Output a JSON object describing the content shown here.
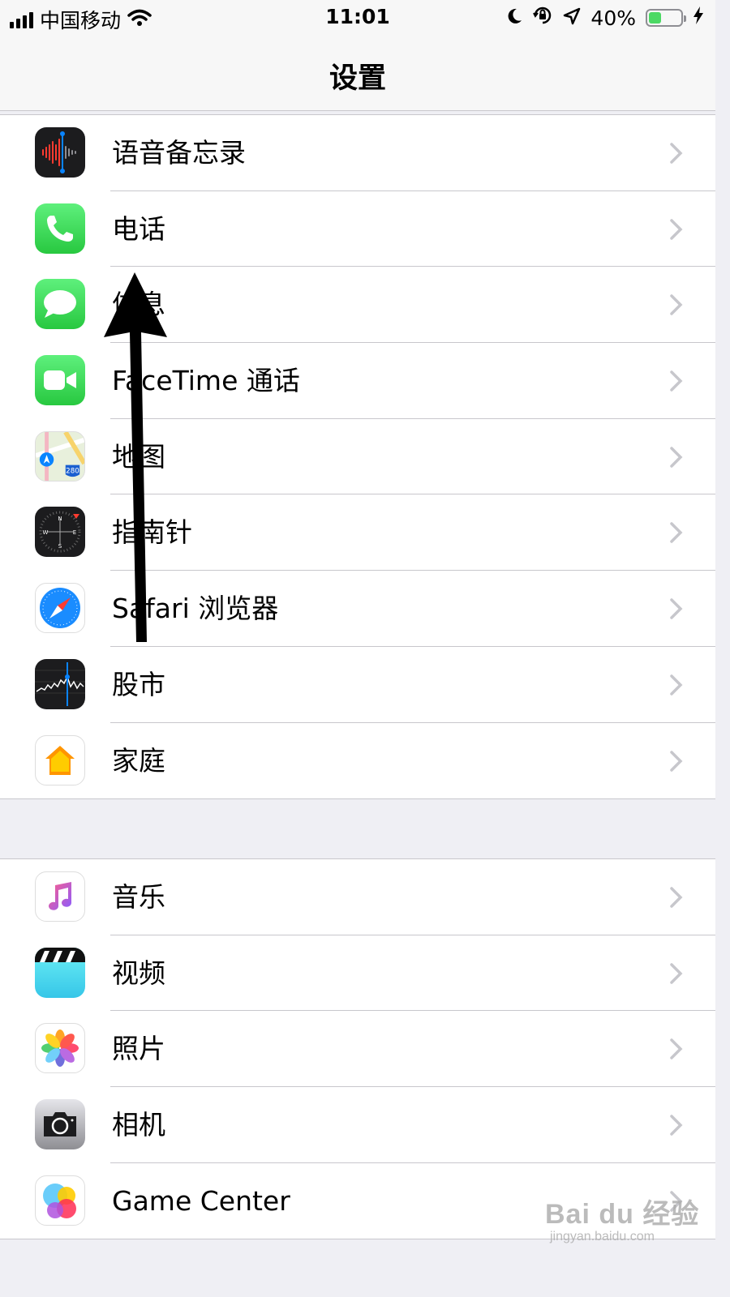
{
  "status_bar": {
    "carrier": "中国移动",
    "time": "11:01",
    "battery_percent": "40%",
    "battery_level": 0.4,
    "icons": [
      "signal-icon",
      "wifi-icon",
      "moon-icon",
      "orientation-lock-icon",
      "location-icon",
      "battery-icon",
      "charging-icon"
    ]
  },
  "header": {
    "title": "设置"
  },
  "groups": [
    {
      "items": [
        {
          "label": "语音备忘录",
          "icon": "voice-memos-icon"
        },
        {
          "label": "电话",
          "icon": "phone-icon"
        },
        {
          "label": "信息",
          "icon": "messages-icon"
        },
        {
          "label": "FaceTime 通话",
          "icon": "facetime-icon"
        },
        {
          "label": "地图",
          "icon": "maps-icon"
        },
        {
          "label": "指南针",
          "icon": "compass-icon"
        },
        {
          "label": "Safari 浏览器",
          "icon": "safari-icon"
        },
        {
          "label": "股市",
          "icon": "stocks-icon"
        },
        {
          "label": "家庭",
          "icon": "home-icon"
        }
      ]
    },
    {
      "items": [
        {
          "label": "音乐",
          "icon": "music-icon"
        },
        {
          "label": "视频",
          "icon": "videos-icon"
        },
        {
          "label": "照片",
          "icon": "photos-icon"
        },
        {
          "label": "相机",
          "icon": "camera-icon"
        },
        {
          "label": "Game Center",
          "icon": "game-center-icon"
        }
      ]
    }
  ],
  "watermark": {
    "brand": "Bai du 经验",
    "url": "jingyan.baidu.com"
  },
  "colors": {
    "battery_fill": "#4cd964",
    "separator": "#c8c7cc",
    "background": "#efeff4"
  }
}
